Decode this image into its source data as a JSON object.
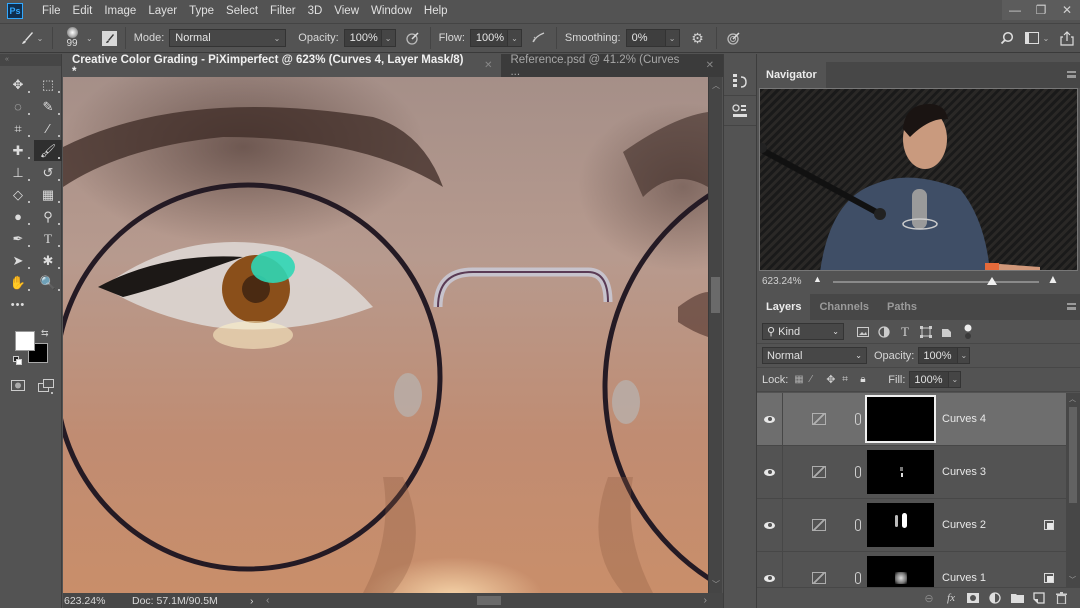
{
  "app": {
    "logo": "Ps"
  },
  "menu": [
    "File",
    "Edit",
    "Image",
    "Layer",
    "Type",
    "Select",
    "Filter",
    "3D",
    "View",
    "Window",
    "Help"
  ],
  "window_controls": {
    "minimize": "—",
    "restore": "❐",
    "close": "✕"
  },
  "options_bar": {
    "brush_size": "99",
    "mode_label": "Mode:",
    "mode_value": "Normal",
    "opacity_label": "Opacity:",
    "opacity_value": "100%",
    "flow_label": "Flow:",
    "flow_value": "100%",
    "smoothing_label": "Smoothing:",
    "smoothing_value": "0%"
  },
  "tools": [
    {
      "name": "move-tool",
      "glyph": "✥"
    },
    {
      "name": "marquee-tool",
      "glyph": "⬚"
    },
    {
      "name": "lasso-tool",
      "glyph": "◌"
    },
    {
      "name": "quick-selection-tool",
      "glyph": "✎"
    },
    {
      "name": "crop-tool",
      "glyph": "⌗"
    },
    {
      "name": "eyedropper-tool",
      "glyph": "⁄"
    },
    {
      "name": "healing-brush-tool",
      "glyph": "✚"
    },
    {
      "name": "brush-tool",
      "glyph": "🖌",
      "active": true
    },
    {
      "name": "clone-stamp-tool",
      "glyph": "⊥"
    },
    {
      "name": "history-brush-tool",
      "glyph": "↺"
    },
    {
      "name": "eraser-tool",
      "glyph": "◇"
    },
    {
      "name": "gradient-tool",
      "glyph": "▦"
    },
    {
      "name": "blur-tool",
      "glyph": "●"
    },
    {
      "name": "dodge-tool",
      "glyph": "⚲"
    },
    {
      "name": "pen-tool",
      "glyph": "✒"
    },
    {
      "name": "type-tool",
      "glyph": "T"
    },
    {
      "name": "path-selection-tool",
      "glyph": "➤"
    },
    {
      "name": "custom-shape-tool",
      "glyph": "✱"
    },
    {
      "name": "hand-tool",
      "glyph": "✋"
    },
    {
      "name": "zoom-tool",
      "glyph": "🔍"
    },
    {
      "name": "edit-toolbar",
      "glyph": "•••"
    }
  ],
  "colors": {
    "foreground": "#ffffff",
    "background": "#000000",
    "ui_bg": "#535353",
    "ui_dark": "#3b3b3b",
    "selected_layer": "#6e6e6e"
  },
  "document_tabs": [
    {
      "title": "Creative Color Grading - PiXimperfect @ 623% (Curves 4, Layer Mask/8) *",
      "active": true
    },
    {
      "title": "Reference.psd @ 41.2% (Curves ...",
      "active": false
    }
  ],
  "status_bar": {
    "zoom": "623.24%",
    "doc_info": "Doc: 57.1M/90.5M",
    "arrow": "›"
  },
  "navigator": {
    "title": "Navigator",
    "zoom": "623.24%",
    "zoom_slider_fraction": 0.77
  },
  "layers_panel": {
    "tabs": [
      "Layers",
      "Channels",
      "Paths"
    ],
    "active_tab": "Layers",
    "filter_label": "Kind",
    "blend_mode": "Normal",
    "opacity_label": "Opacity:",
    "opacity_value": "100%",
    "lock_label": "Lock:",
    "fill_label": "Fill:",
    "fill_value": "100%",
    "layers": [
      {
        "name": "Curves 4",
        "visible": true,
        "selected": true,
        "type": "curves-adjustment",
        "clipped": false
      },
      {
        "name": "Curves 3",
        "visible": true,
        "selected": false,
        "type": "curves-adjustment",
        "clipped": false
      },
      {
        "name": "Curves 2",
        "visible": true,
        "selected": false,
        "type": "curves-adjustment",
        "clipped": true
      },
      {
        "name": "Curves 1",
        "visible": true,
        "selected": false,
        "type": "curves-adjustment",
        "clipped": true
      }
    ]
  }
}
